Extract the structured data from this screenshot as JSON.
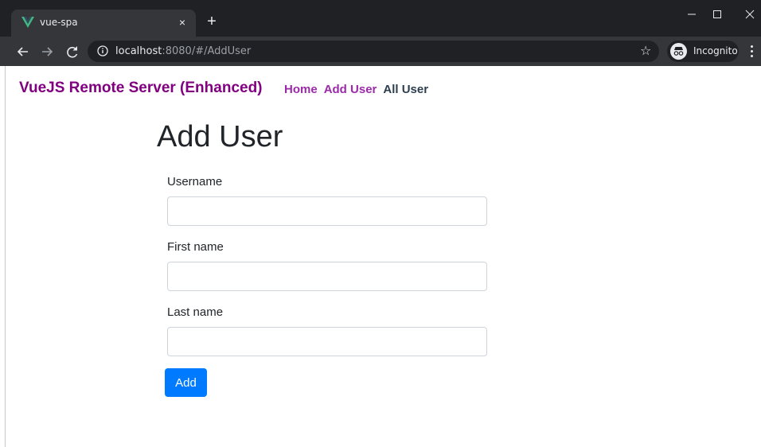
{
  "browser": {
    "tab_title": "vue-spa",
    "tab_close_glyph": "×",
    "new_tab_glyph": "+",
    "url_host": "localhost",
    "url_rest": ":8080/#/AddUser",
    "incognito_label": "Incognito",
    "icons": {
      "favicon": "vue-logo-icon",
      "back": "arrow-left-icon",
      "forward": "arrow-right-icon",
      "reload": "reload-icon",
      "info": "info-icon",
      "bookmark": "star-icon",
      "incognito": "incognito-icon",
      "menu": "kebab-menu-icon"
    }
  },
  "app": {
    "brand": "VueJS Remote Server (Enhanced)",
    "nav": [
      {
        "label": "Home"
      },
      {
        "label": "Add User"
      },
      {
        "label": "All User"
      }
    ]
  },
  "form": {
    "heading": "Add User",
    "fields": [
      {
        "label": "Username",
        "value": "",
        "placeholder": ""
      },
      {
        "label": "First name",
        "value": "",
        "placeholder": ""
      },
      {
        "label": "Last name",
        "value": "",
        "placeholder": ""
      }
    ],
    "submit_label": "Add"
  },
  "colors": {
    "brand": "#80007f",
    "nav_link": "#9b2aa8",
    "nav_active": "#2c3e50",
    "primary_button": "#007bff"
  }
}
